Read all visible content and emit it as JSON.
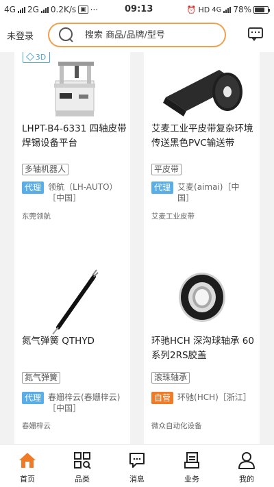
{
  "status_bar": {
    "left_text": "4G",
    "sim2_text": "2G",
    "speed": "0.2K/s",
    "time": "09:13",
    "hd": "HD",
    "net": "4G",
    "battery": "78%",
    "battery_level": 0.78
  },
  "header": {
    "login": "未登录",
    "search_placeholder": "搜索 商品/品牌/型号"
  },
  "products": [
    {
      "badge_3d": "3D",
      "title": "LHPT-B4-6331 四轴皮带焊锡设备平台",
      "tag": "多轴机器人",
      "badge": "代理",
      "brand": "领航（LH-AUTO）［中国］",
      "company": "东莞领航"
    },
    {
      "title": "艾麦工业平皮带复杂环境传送黑色PVC输送带",
      "tag": "平皮带",
      "badge": "代理",
      "brand": "艾麦(aimai)［中国］",
      "company": "艾麦工业皮带"
    },
    {
      "title": "氮气弹簧 QTHYD",
      "tag": "氮气弹簧",
      "badge": "代理",
      "brand": "春姗梓云(春姗梓云)［中国］",
      "company": "春姗梓云"
    },
    {
      "title": "环驰HCH 深沟球轴承 60系列2RS胶盖",
      "tag": "滚珠轴承",
      "badge": "自营",
      "brand": "环驰(HCH)［浙江］",
      "company": "微众自动化设备"
    }
  ],
  "nav": {
    "home": "首页",
    "category": "品类",
    "messages": "消息",
    "business": "业务",
    "mine": "我的"
  },
  "colors": {
    "accent": "#f07b26",
    "search_border": "#f0a04b",
    "agent_badge": "#5aaee8"
  }
}
